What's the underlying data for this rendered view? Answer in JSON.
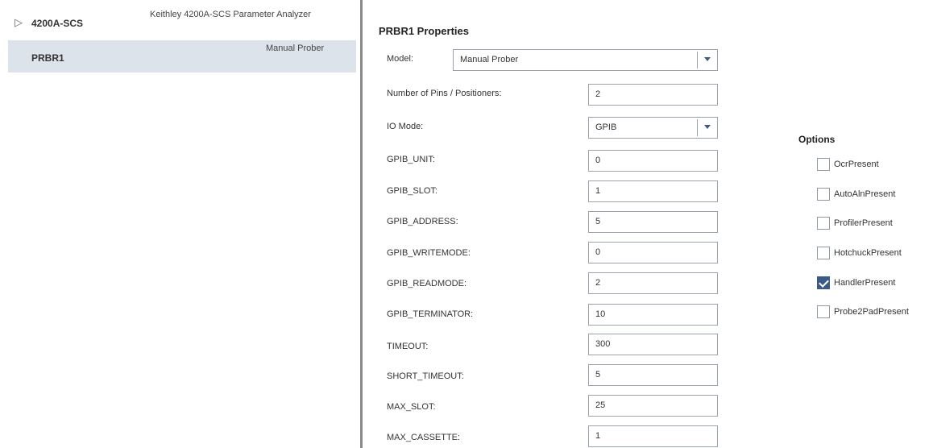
{
  "tree": {
    "root": {
      "label": "4200A-SCS",
      "description": "Keithley 4200A-SCS Parameter Analyzer"
    },
    "child": {
      "label": "PRBR1",
      "description": "Manual Prober"
    }
  },
  "properties": {
    "title": "PRBR1 Properties",
    "model": {
      "label": "Model:",
      "value": "Manual Prober"
    },
    "pins": {
      "label": "Number of Pins / Positioners:",
      "value": "2"
    },
    "io_mode": {
      "label": "IO Mode:",
      "value": "GPIB"
    },
    "gpib_unit": {
      "label": "GPIB_UNIT:",
      "value": "0"
    },
    "gpib_slot": {
      "label": "GPIB_SLOT:",
      "value": "1"
    },
    "gpib_address": {
      "label": "GPIB_ADDRESS:",
      "value": "5"
    },
    "gpib_writemode": {
      "label": "GPIB_WRITEMODE:",
      "value": "0"
    },
    "gpib_readmode": {
      "label": "GPIB_READMODE:",
      "value": "2"
    },
    "gpib_terminator": {
      "label": "GPIB_TERMINATOR:",
      "value": "10"
    },
    "timeout": {
      "label": "TIMEOUT:",
      "value": "300"
    },
    "short_timeout": {
      "label": "SHORT_TIMEOUT:",
      "value": "5"
    },
    "max_slot": {
      "label": "MAX_SLOT:",
      "value": "25"
    },
    "max_cassette": {
      "label": "MAX_CASSETTE:",
      "value": "1"
    }
  },
  "options": {
    "title": "Options",
    "items": [
      {
        "label": "OcrPresent",
        "checked": false
      },
      {
        "label": "AutoAlnPresent",
        "checked": false
      },
      {
        "label": "ProfilerPresent",
        "checked": false
      },
      {
        "label": "HotchuckPresent",
        "checked": false
      },
      {
        "label": "HandlerPresent",
        "checked": true
      },
      {
        "label": "Probe2PadPresent",
        "checked": false
      }
    ]
  }
}
